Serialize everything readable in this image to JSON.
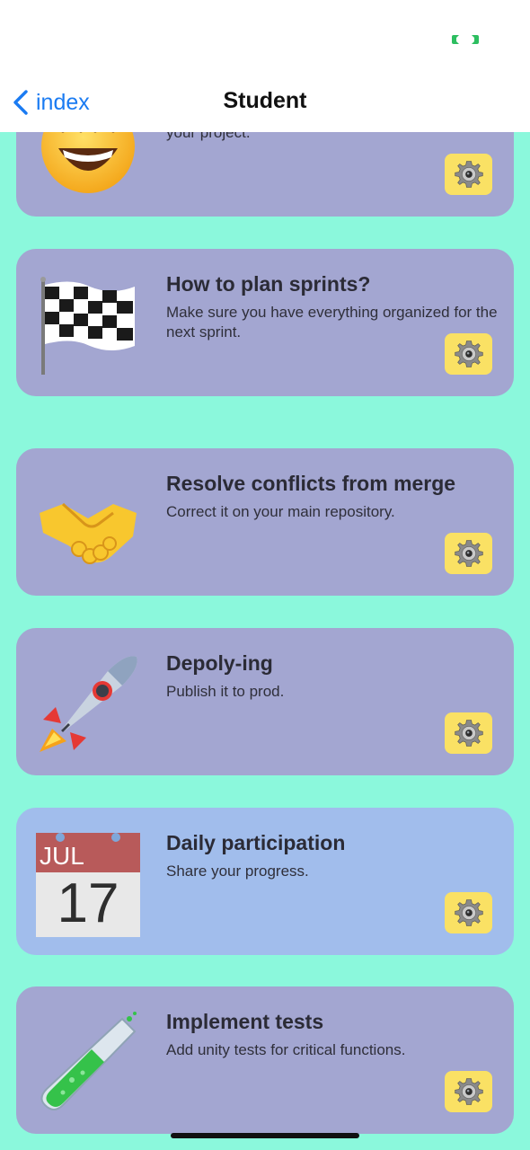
{
  "status_bar": {
    "cast_icon": "screen-cast-icon",
    "cast_color": "#2DBE60"
  },
  "nav": {
    "back_label": "index",
    "back_icon": "chevron-left-icon",
    "title": "Student",
    "accent_color": "#1A7BF2"
  },
  "colors": {
    "background": "#8BF8DC",
    "card": "#A3A6D1",
    "card_highlight": "#A1BDEC",
    "gear_button": "#FAE164"
  },
  "cards": [
    {
      "icon": "grinning-face-icon",
      "title": "",
      "description": "your project.",
      "action_icon": "gear-icon"
    },
    {
      "icon": "checkered-flag-icon",
      "title": "How to plan sprints?",
      "description": "Make sure you have everything organized for the next sprint.",
      "action_icon": "gear-icon"
    },
    {
      "icon": "handshake-icon",
      "title": "Resolve conflicts from merge",
      "description": "Correct it on your main repository.",
      "action_icon": "gear-icon"
    },
    {
      "icon": "rocket-icon",
      "title": "Depoly-ing",
      "description": "Publish it to prod.",
      "action_icon": "gear-icon"
    },
    {
      "icon": "calendar-icon",
      "title": "Daily participation",
      "description": "Share your progress.",
      "action_icon": "gear-icon",
      "calendar_month": "JUL",
      "calendar_day": "17"
    },
    {
      "icon": "test-tube-icon",
      "title": "Implement tests",
      "description": "Add unity tests for critical functions.",
      "action_icon": "gear-icon"
    }
  ]
}
